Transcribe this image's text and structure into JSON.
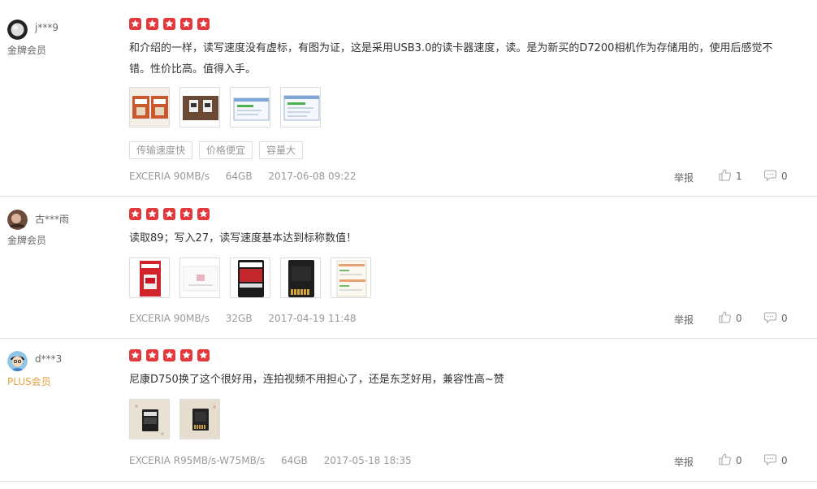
{
  "reviews": [
    {
      "user": "j***9",
      "level": "金牌会员",
      "rating": 5,
      "content": "和介绍的一样，读写速度没有虚标，有图为证，这是采用USB3.0的读卡器速度，读。是为新买的D7200相机作为存储用的，使用后感觉不错。性价比高。值得入手。",
      "images": [
        "product-photo-sd-cards",
        "product-photo-cards-dark",
        "screenshot-speed-test-1",
        "screenshot-speed-test-2"
      ],
      "tags": [
        "传输速度快",
        "价格便宜",
        "容量大"
      ],
      "meta": {
        "model": "EXCERIA 90MB/s",
        "capacity": "64GB",
        "date": "2017-06-08 09:22"
      },
      "report": "举报",
      "likes": "1",
      "replies": "0"
    },
    {
      "user": "古***雨",
      "level": "金牌会员",
      "rating": 5,
      "content": "读取89；写入27，读写速度基本达到标称数值！",
      "images": [
        "product-photo-package-red",
        "product-photo-white",
        "product-photo-card-front",
        "product-photo-card-back",
        "screenshot-speed-test"
      ],
      "tags": [],
      "meta": {
        "model": "EXCERIA 90MB/s",
        "capacity": "32GB",
        "date": "2017-04-19 11:48"
      },
      "report": "举报",
      "likes": "0",
      "replies": "0"
    },
    {
      "user": "d***3",
      "level": "PLUS会员",
      "rating": 5,
      "content": "尼康D750换了这个很好用，连拍视频不用担心了，还是东芝好用，兼容性高~赞",
      "images": [
        "product-photo-card-table-1",
        "product-photo-card-table-2"
      ],
      "tags": [],
      "meta": {
        "model": "EXCERIA R95MB/s-W75MB/s",
        "capacity": "64GB",
        "date": "2017-05-18 18:35"
      },
      "report": "举报",
      "likes": "0",
      "replies": "0"
    }
  ],
  "colors": {
    "star": "#e4393c",
    "plus": "#e4a23c",
    "muted": "#999999"
  }
}
